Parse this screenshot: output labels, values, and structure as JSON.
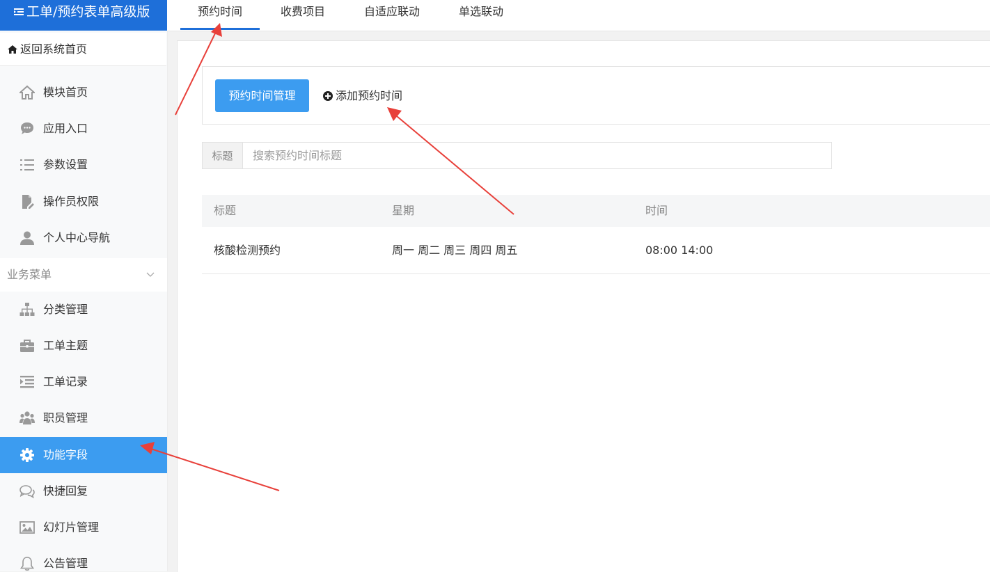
{
  "brand": {
    "title": "工单/预约表单高级版"
  },
  "sidebar": {
    "home_link": "返回系统首页",
    "items": [
      {
        "label": "模块首页",
        "icon": "home-icon"
      },
      {
        "label": "应用入口",
        "icon": "chat-bubble-icon"
      },
      {
        "label": "参数设置",
        "icon": "list-icon"
      },
      {
        "label": "操作员权限",
        "icon": "document-edit-icon"
      },
      {
        "label": "个人中心导航",
        "icon": "user-icon"
      }
    ],
    "section_title": "业务菜单",
    "business_items": [
      {
        "label": "分类管理",
        "icon": "sitemap-icon"
      },
      {
        "label": "工单主题",
        "icon": "briefcase-icon"
      },
      {
        "label": "工单记录",
        "icon": "indent-list-icon"
      },
      {
        "label": "职员管理",
        "icon": "users-icon"
      },
      {
        "label": "功能字段",
        "icon": "gear-icon",
        "active": true
      },
      {
        "label": "快捷回复",
        "icon": "comments-icon"
      },
      {
        "label": "幻灯片管理",
        "icon": "image-icon"
      },
      {
        "label": "公告管理",
        "icon": "bell-icon"
      }
    ]
  },
  "tabs": [
    {
      "label": "预约时间",
      "active": true
    },
    {
      "label": "收费项目"
    },
    {
      "label": "自适应联动"
    },
    {
      "label": "单选联动"
    }
  ],
  "toolbar": {
    "primary_button": "预约时间管理",
    "add_link": "添加预约时间"
  },
  "search": {
    "label": "标题",
    "placeholder": "搜索预约时间标题"
  },
  "table": {
    "headers": [
      "标题",
      "星期",
      "时间"
    ],
    "rows": [
      [
        "核酸检测预约",
        "周一 周二 周三 周四 周五",
        "08:00 14:00"
      ]
    ]
  },
  "colors": {
    "brand": "#1e6fd9",
    "accent": "#3c9cf0",
    "annotation_arrow": "#e8403a"
  }
}
